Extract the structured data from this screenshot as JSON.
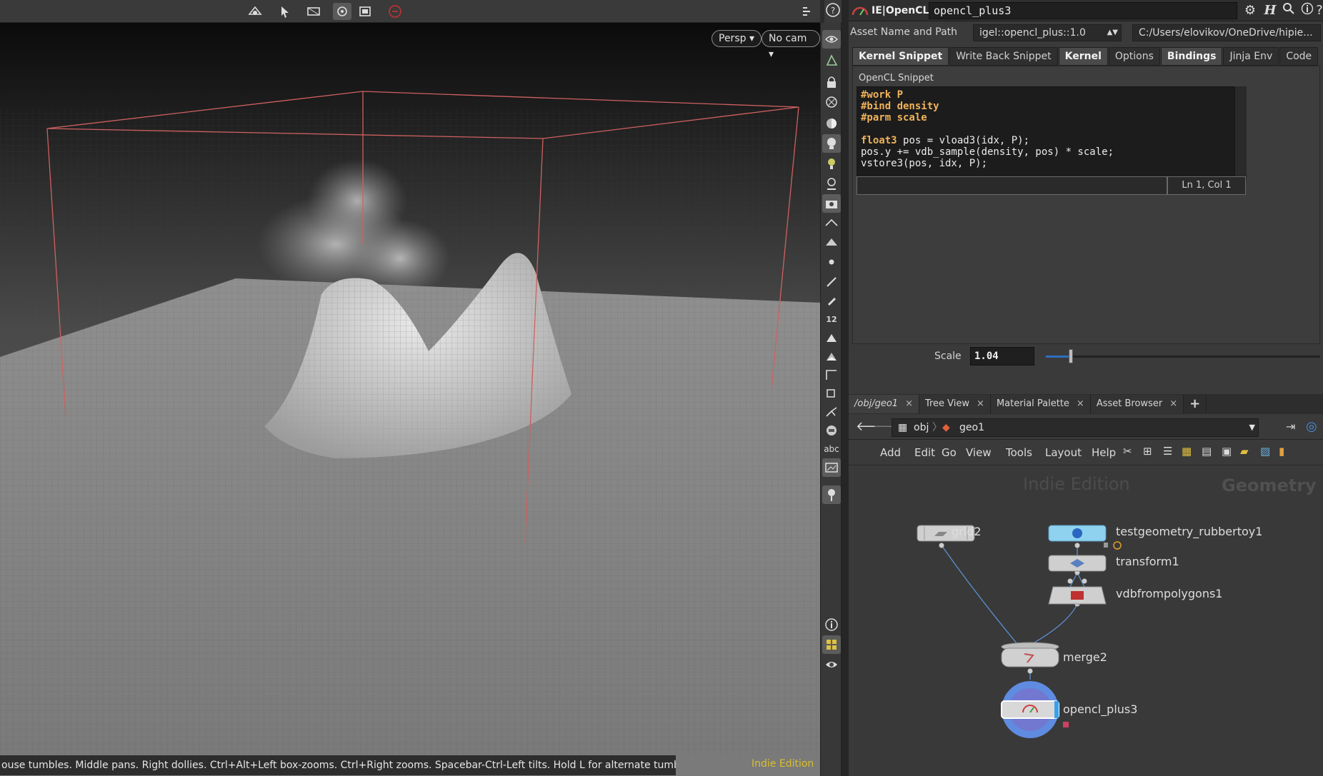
{
  "viewport": {
    "toolbar_icons": [
      "tumble-icon",
      "select-icon",
      "transform-icon",
      "view-icon",
      "display-icon",
      "stop-icon"
    ],
    "persp_label": "Persp",
    "cam_label": "No cam",
    "status_text": "ouse tumbles. Middle pans. Right dollies. Ctrl+Alt+Left box-zooms. Ctrl+Right zooms. Spacebar-Ctrl-Left tilts. Hold L for alternate tumble, dolly, and zoom.",
    "edition": "Indie Edition"
  },
  "shelf": {
    "icons": [
      "eye-icon",
      "geometry-icon",
      "lock-icon",
      "ghost-icon",
      "shading-icon",
      "light-icon",
      "headlight-icon",
      "light-bulb-icon",
      "camera-icon",
      "snap-icon",
      "snap2-icon",
      "point-icon",
      "brush-icon",
      "pen-icon",
      "number-icon",
      "paint-icon",
      "primitive-icon",
      "curve-icon",
      "scale-icon",
      "bone-icon",
      "circle-icon",
      "text-icon",
      "image-icon",
      "pin-icon",
      "info-icon",
      "grid-icon",
      "visibility-icon"
    ],
    "text_icon_label": "abc",
    "number_label": "12"
  },
  "params": {
    "node_type": "IE|OpenCL+",
    "node_name": "opencl_plus3",
    "asset_label": "Asset Name and Path",
    "asset_name": "igel::opencl_plus::1.0",
    "asset_path": "C:/Users/elovikov/OneDrive/hipie...",
    "tabs": [
      {
        "label": "Kernel Snippet",
        "active": true
      },
      {
        "label": "Write Back Snippet",
        "active": false
      },
      {
        "label": "Kernel",
        "active": true
      },
      {
        "label": "Options",
        "active": false
      },
      {
        "label": "Bindings",
        "active": true
      },
      {
        "label": "Jinja Env",
        "active": false
      },
      {
        "label": "Code",
        "active": false
      }
    ],
    "code_label": "OpenCL Snippet",
    "code_lines": [
      "#work P",
      "#bind density",
      "#parm scale",
      "",
      "float3 pos = vload3(idx, P);",
      "pos.y += vdb_sample(density, pos) * scale;",
      "vstore3(pos, idx, P);"
    ],
    "cursor_pos": "Ln 1, Col 1",
    "scale_label": "Scale",
    "scale_value": "1.04",
    "scale_fraction": 0.09
  },
  "network": {
    "tabs": [
      {
        "label": "/obj/geo1",
        "active": true
      },
      {
        "label": "Tree View",
        "active": false
      },
      {
        "label": "Material Palette",
        "active": false
      },
      {
        "label": "Asset Browser",
        "active": false
      }
    ],
    "path": [
      "obj",
      "geo1"
    ],
    "menu": [
      "Add",
      "Edit",
      "Go",
      "View",
      "Tools",
      "Layout",
      "Help"
    ],
    "watermark_edition": "Indie Edition",
    "watermark_context": "Geometry",
    "nodes": [
      {
        "id": "grid2",
        "label": "grid2"
      },
      {
        "id": "rubbertoy",
        "label": "testgeometry_rubbertoy1"
      },
      {
        "id": "transform1",
        "label": "transform1"
      },
      {
        "id": "vdb",
        "label": "vdbfrompolygons1"
      },
      {
        "id": "merge2",
        "label": "merge2"
      },
      {
        "id": "opencl",
        "label": "opencl_plus3"
      }
    ],
    "accent_blue": "#3aa0e8",
    "display_flag_color": "#5f8be0"
  }
}
